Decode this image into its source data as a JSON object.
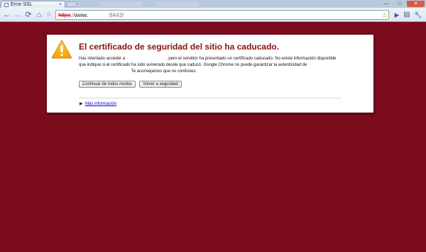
{
  "tab": {
    "title": "Error SSL",
    "close": "×"
  },
  "window": {
    "min": "—",
    "max": "□",
    "close": "✕"
  },
  "toolbar": {
    "back_icon": "←",
    "forward_icon": "→",
    "reload_icon": "⟳",
    "home_icon": "⌂",
    "star_icon": "☆",
    "url_scheme": "https",
    "url_sep": "://",
    "url_host": "www.",
    "url_port": ":8443/",
    "warning_icon": "⚠",
    "go_icon": "▶",
    "page_menu_icon": "▤",
    "wrench_icon": "🔧"
  },
  "interstitial": {
    "heading": "El certificado de seguridad del sitio ha caducado.",
    "line1_pre": "Has intentado acceder a",
    "line1_post": ", pero el servidor ha presentado un certificado caducado. No existe información disponible",
    "line2": "que indique si el certificado ha sido vulnerado desde que caducó. Google Chrome no puede garantizar la autenticidad de",
    "line3": "Te aconsejamos que no continúes.",
    "proceed_button": "Continuar de todos modos",
    "back_button": "Volver a seguridad",
    "more_info_arrow": "▶",
    "more_info": "Más información"
  },
  "colors": {
    "background": "#7a0c1d",
    "heading": "#881111",
    "link": "#0000cc"
  }
}
